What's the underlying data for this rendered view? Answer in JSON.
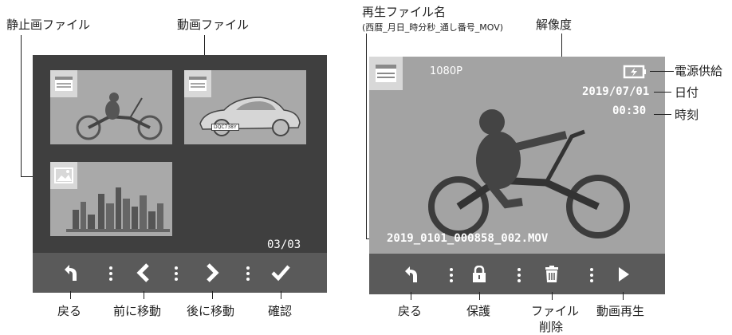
{
  "left_panel": {
    "callouts": {
      "still_file": "静止画ファイル",
      "video_file": "動画ファイル"
    },
    "thumbnails": [
      {
        "kind": "video",
        "icon": "clapperboard-icon",
        "subject": "motorcycle rider"
      },
      {
        "kind": "video",
        "icon": "clapperboard-icon",
        "subject": "vintage car",
        "plate": "DQC738Y"
      },
      {
        "kind": "still",
        "icon": "image-icon",
        "subject": "city skyline"
      }
    ],
    "page_counter": "03/03",
    "toolbar_labels": {
      "back": "戻る",
      "prev": "前に移動",
      "next": "後に移動",
      "confirm": "確認"
    }
  },
  "right_panel": {
    "callouts": {
      "filename_title": "再生ファイル名",
      "filename_format": "(西暦_月日_時分秒_通し番号_MOV)",
      "resolution": "解像度",
      "power": "電源供給",
      "date": "日付",
      "time": "時刻"
    },
    "overlay": {
      "resolution": "1080P",
      "date": "2019/07/01",
      "time": "00:30",
      "filename": "2019_0101_000858_002.MOV"
    },
    "toolbar_labels": {
      "back": "戻る",
      "protect": "保護",
      "delete_line1": "ファイル",
      "delete_line2": "削除",
      "play": "動画再生"
    }
  },
  "colors": {
    "screen_bg": "#3f3f3f",
    "thumb_bg": "#a9a9a9",
    "toolbar_bg": "#5a5a5a",
    "overlay_text": "#ffffff"
  }
}
